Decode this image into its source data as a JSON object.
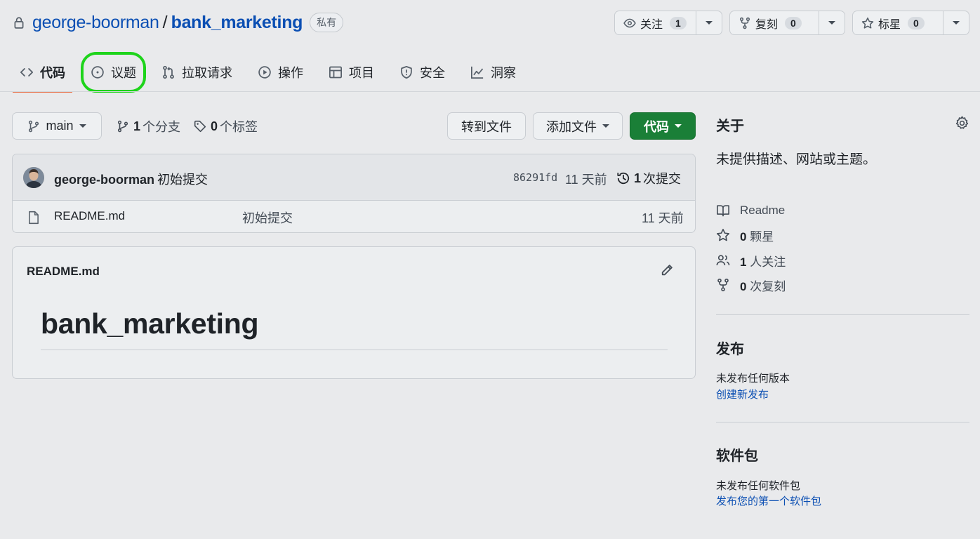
{
  "header": {
    "owner": "george-boorman",
    "separator": "/",
    "repo": "bank_marketing",
    "visibility": "私有",
    "watch": {
      "label": "关注",
      "count": "1"
    },
    "fork": {
      "label": "复刻",
      "count": "0"
    },
    "star": {
      "label": "标星",
      "count": "0"
    }
  },
  "tabs": [
    {
      "label": "代码",
      "icon": "code-icon",
      "active": true
    },
    {
      "label": "议题",
      "icon": "issue-opened-icon",
      "highlighted": true
    },
    {
      "label": "拉取请求",
      "icon": "git-pull-request-icon"
    },
    {
      "label": "操作",
      "icon": "play-icon"
    },
    {
      "label": "项目",
      "icon": "table-icon"
    },
    {
      "label": "安全",
      "icon": "shield-icon"
    },
    {
      "label": "洞察",
      "icon": "graph-icon"
    }
  ],
  "highlight_color": "#1ed41b",
  "branch_bar": {
    "branch": "main",
    "branches_count": "1",
    "branches_label": "个分支",
    "tags_count": "0",
    "tags_label": "个标签",
    "goto_file": "转到文件",
    "add_file": "添加文件",
    "code_button": "代码",
    "code_button_color": "#1a7f37"
  },
  "latest_commit": {
    "author": "george-boorman",
    "message": "初始提交",
    "hash": "86291fd",
    "time": "11 天前",
    "commit_count": "1",
    "commit_label": "次提交"
  },
  "files": [
    {
      "name": "README.md",
      "message": "初始提交",
      "time": "11 天前",
      "icon": "file-icon"
    }
  ],
  "readme": {
    "title": "README.md",
    "heading": "bank_marketing"
  },
  "sidebar": {
    "about_title": "关于",
    "description": "未提供描述、网站或主题。",
    "items": [
      {
        "icon": "book-icon",
        "count": "",
        "label": "Readme"
      },
      {
        "icon": "star-icon",
        "count": "0",
        "label": "颗星"
      },
      {
        "icon": "people-icon",
        "count": "1",
        "label": "人关注"
      },
      {
        "icon": "fork-icon",
        "count": "0",
        "label": "次复刻"
      }
    ],
    "releases": {
      "title": "发布",
      "empty": "未发布任何版本",
      "link": "创建新发布"
    },
    "packages": {
      "title": "软件包",
      "empty": "未发布任何软件包",
      "link": "发布您的第一个软件包"
    }
  }
}
